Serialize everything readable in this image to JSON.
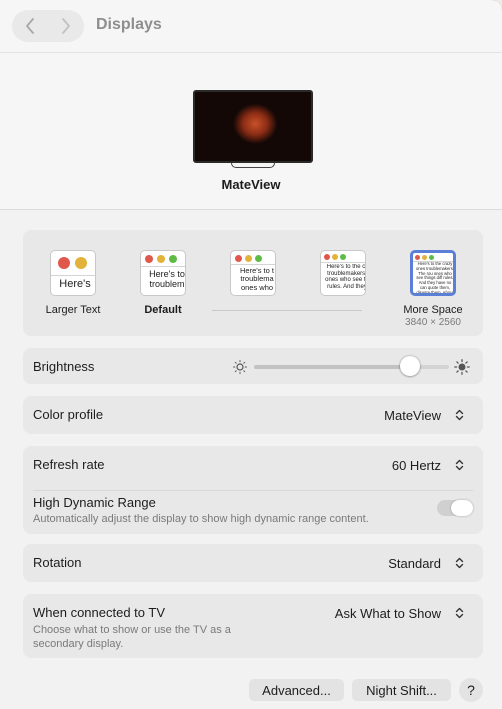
{
  "toolbar": {
    "title": "Displays",
    "back_icon": "chevron-left-icon",
    "forward_icon": "chevron-right-icon"
  },
  "display": {
    "name": "MateView"
  },
  "resolution": {
    "options": [
      {
        "label": "Larger Text",
        "sample": "Here's",
        "sublabel": ""
      },
      {
        "label": "Default",
        "sample": "Here's to troublem",
        "sublabel": ""
      },
      {
        "label": "",
        "sample": "Here's to t troublema ones who",
        "sublabel": ""
      },
      {
        "label": "",
        "sample": "Here's to the cr troublemakers. ones who see th rules. And they",
        "sublabel": ""
      },
      {
        "label": "More Space",
        "sample": "Here's to the crazy ones troublemakers. The rou ones who see things diff rules. And they have no can quote them, disagre them. About the only th Because they change th",
        "sublabel": "3840 × 2560"
      }
    ],
    "selected_index": 4
  },
  "brightness": {
    "label": "Brightness",
    "level": 0.8
  },
  "color_profile": {
    "label": "Color profile",
    "value": "MateView"
  },
  "refresh_rate": {
    "label": "Refresh rate",
    "value": "60 Hertz"
  },
  "hdr": {
    "label": "High Dynamic Range",
    "description": "Automatically adjust the display to show high dynamic range content.",
    "enabled": false
  },
  "rotation": {
    "label": "Rotation",
    "value": "Standard"
  },
  "tv": {
    "label": "When connected to TV",
    "value": "Ask What to Show",
    "description_line1": "Choose what to show or use the TV as a",
    "description_line2": "secondary display."
  },
  "buttons": {
    "advanced": "Advanced...",
    "night_shift": "Night Shift...",
    "help": "?"
  },
  "colors": {
    "traffic_red": "#e0584b",
    "traffic_yellow": "#e3b23b",
    "traffic_green": "#5dbb46",
    "selected_border": "#5b7fd6"
  }
}
